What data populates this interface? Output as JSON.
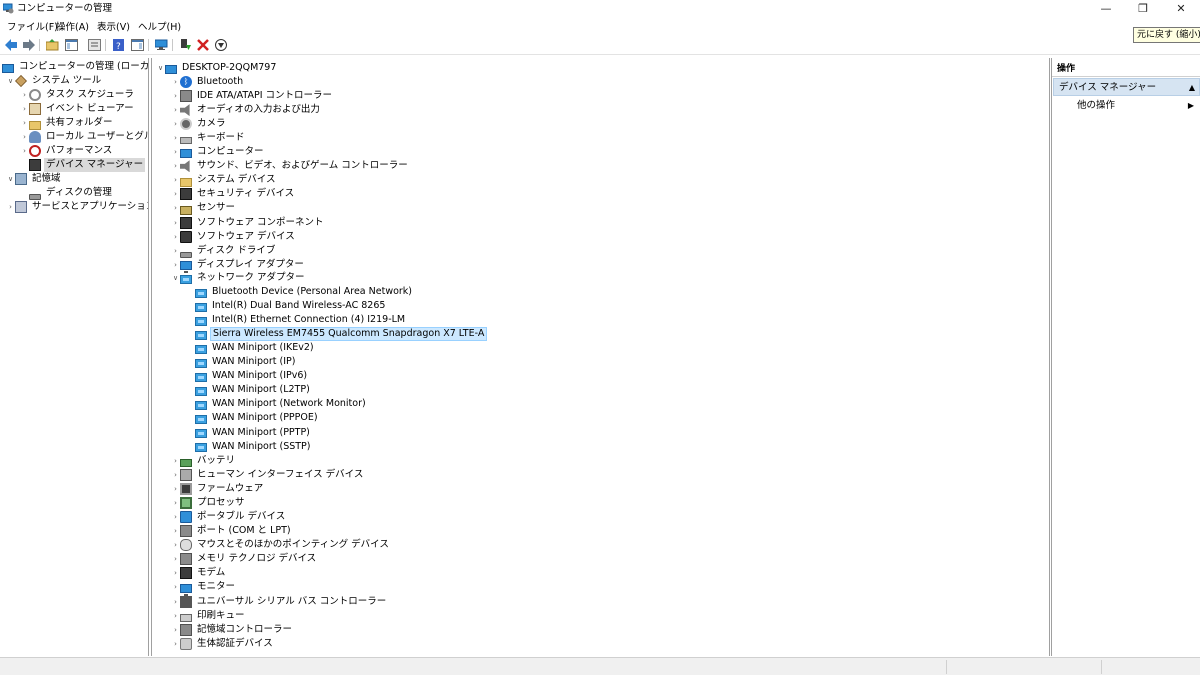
{
  "window": {
    "title": "コンピューターの管理",
    "minimize": "—",
    "restore": "❐",
    "close": "✕",
    "tooltip": "元に戻す (縮小)"
  },
  "menu": [
    "ファイル(F)",
    "操作(A)",
    "表示(V)",
    "ヘルプ(H)"
  ],
  "left_tree": {
    "root": "コンピューターの管理 (ローカル)",
    "system_tools": "システム ツール",
    "task_scheduler": "タスク スケジューラ",
    "event_viewer": "イベント ビューアー",
    "shared_folders": "共有フォルダー",
    "local_users": "ローカル ユーザーとグループ",
    "performance": "パフォーマンス",
    "device_manager": "デバイス マネージャー",
    "storage": "記憶域",
    "disk_management": "ディスクの管理",
    "services": "サービスとアプリケーション"
  },
  "device_tree": {
    "computer": "DESKTOP-2QQM797",
    "categories_before": [
      {
        "label": "Bluetooth",
        "icon": "bluetooth-icon"
      },
      {
        "label": "IDE ATA/ATAPI コントローラー",
        "icon": "ide-controller-icon"
      },
      {
        "label": "オーディオの入力および出力",
        "icon": "speaker-icon"
      },
      {
        "label": "カメラ",
        "icon": "camera-icon"
      },
      {
        "label": "キーボード",
        "icon": "keyboard-icon"
      },
      {
        "label": "コンピューター",
        "icon": "computer-icon"
      },
      {
        "label": "サウンド、ビデオ、およびゲーム コントローラー",
        "icon": "sound-icon"
      },
      {
        "label": "システム デバイス",
        "icon": "system-devices-icon"
      },
      {
        "label": "セキュリティ デバイス",
        "icon": "security-device-icon"
      },
      {
        "label": "センサー",
        "icon": "sensor-icon"
      },
      {
        "label": "ソフトウェア コンポーネント",
        "icon": "software-component-icon"
      },
      {
        "label": "ソフトウェア デバイス",
        "icon": "software-device-icon"
      },
      {
        "label": "ディスク ドライブ",
        "icon": "disk-drive-icon"
      },
      {
        "label": "ディスプレイ アダプター",
        "icon": "display-adapter-icon"
      }
    ],
    "network_category": "ネットワーク アダプター",
    "network_adapters": [
      "Bluetooth Device (Personal Area Network)",
      "Intel(R) Dual Band Wireless-AC 8265",
      "Intel(R) Ethernet Connection (4) I219-LM",
      "Sierra Wireless EM7455 Qualcomm Snapdragon X7 LTE-A",
      "WAN Miniport (IKEv2)",
      "WAN Miniport (IP)",
      "WAN Miniport (IPv6)",
      "WAN Miniport (L2TP)",
      "WAN Miniport (Network Monitor)",
      "WAN Miniport (PPPOE)",
      "WAN Miniport (PPTP)",
      "WAN Miniport (SSTP)"
    ],
    "selected_adapter_index": 3,
    "categories_after": [
      {
        "label": "バッテリ",
        "icon": "battery-icon"
      },
      {
        "label": "ヒューマン インターフェイス デバイス",
        "icon": "hid-icon"
      },
      {
        "label": "ファームウェア",
        "icon": "firmware-icon"
      },
      {
        "label": "プロセッサ",
        "icon": "processor-icon"
      },
      {
        "label": "ポータブル デバイス",
        "icon": "portable-device-icon"
      },
      {
        "label": "ポート (COM と LPT)",
        "icon": "port-icon"
      },
      {
        "label": "マウスとそのほかのポインティング デバイス",
        "icon": "mouse-icon"
      },
      {
        "label": "メモリ テクノロジ デバイス",
        "icon": "memory-icon"
      },
      {
        "label": "モデム",
        "icon": "modem-icon"
      },
      {
        "label": "モニター",
        "icon": "monitor-icon"
      },
      {
        "label": "ユニバーサル シリアル バス コントローラー",
        "icon": "usb-icon"
      },
      {
        "label": "印刷キュー",
        "icon": "printer-icon"
      },
      {
        "label": "記憶域コントローラー",
        "icon": "storage-controller-icon"
      },
      {
        "label": "生体認証デバイス",
        "icon": "biometric-icon"
      }
    ]
  },
  "actions": {
    "header": "操作",
    "section": "デバイス マネージャー",
    "other": "他の操作"
  }
}
